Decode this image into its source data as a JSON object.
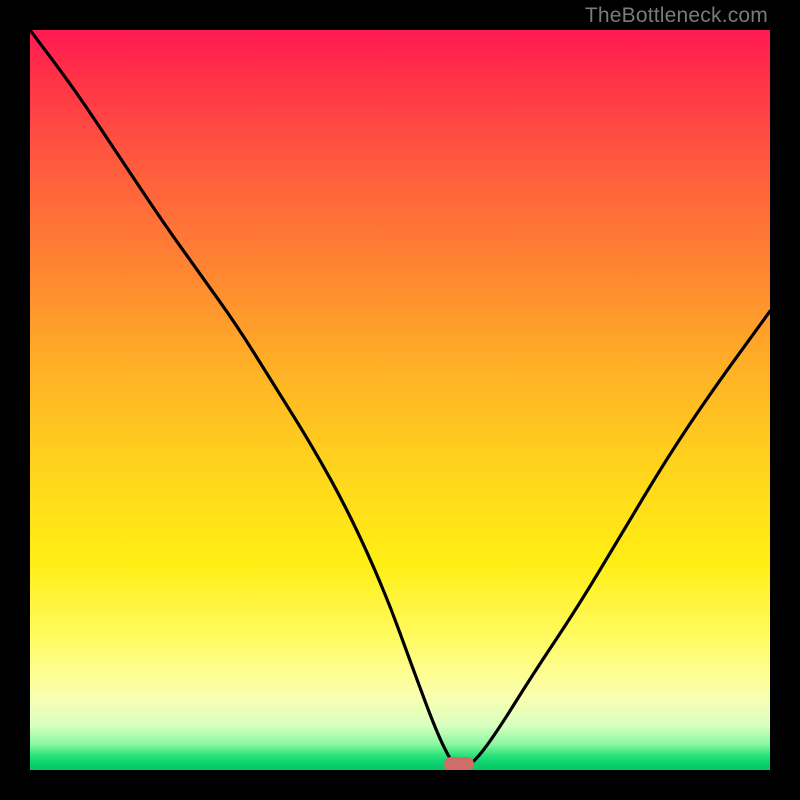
{
  "watermark": "TheBottleneck.com",
  "marker": {
    "x_pct": 58,
    "y_pct": 99.2,
    "color": "#cf6d68"
  },
  "chart_data": {
    "type": "line",
    "title": "",
    "xlabel": "",
    "ylabel": "",
    "xlim": [
      0,
      100
    ],
    "ylim": [
      0,
      100
    ],
    "gradient_stops": [
      {
        "pct": 0,
        "color": "#ff1a52"
      },
      {
        "pct": 18,
        "color": "#ff5a3e"
      },
      {
        "pct": 46,
        "color": "#ffb126"
      },
      {
        "pct": 72,
        "color": "#ffee14"
      },
      {
        "pct": 90,
        "color": "#fbffb0"
      },
      {
        "pct": 98,
        "color": "#2de37c"
      },
      {
        "pct": 100,
        "color": "#07c566"
      }
    ],
    "series": [
      {
        "name": "bottleneck-curve",
        "x": [
          0,
          6,
          12,
          18,
          23,
          28,
          33,
          38,
          43,
          48,
          52,
          55,
          57,
          58,
          60,
          63,
          68,
          74,
          80,
          86,
          92,
          100
        ],
        "y": [
          100,
          92,
          83,
          74,
          67,
          60,
          52,
          44,
          35,
          24,
          13,
          5,
          1,
          0,
          1,
          5,
          13,
          22,
          32,
          42,
          51,
          62
        ]
      }
    ],
    "annotations": [
      {
        "name": "optimal-marker",
        "x": 58,
        "y": 0
      }
    ]
  }
}
